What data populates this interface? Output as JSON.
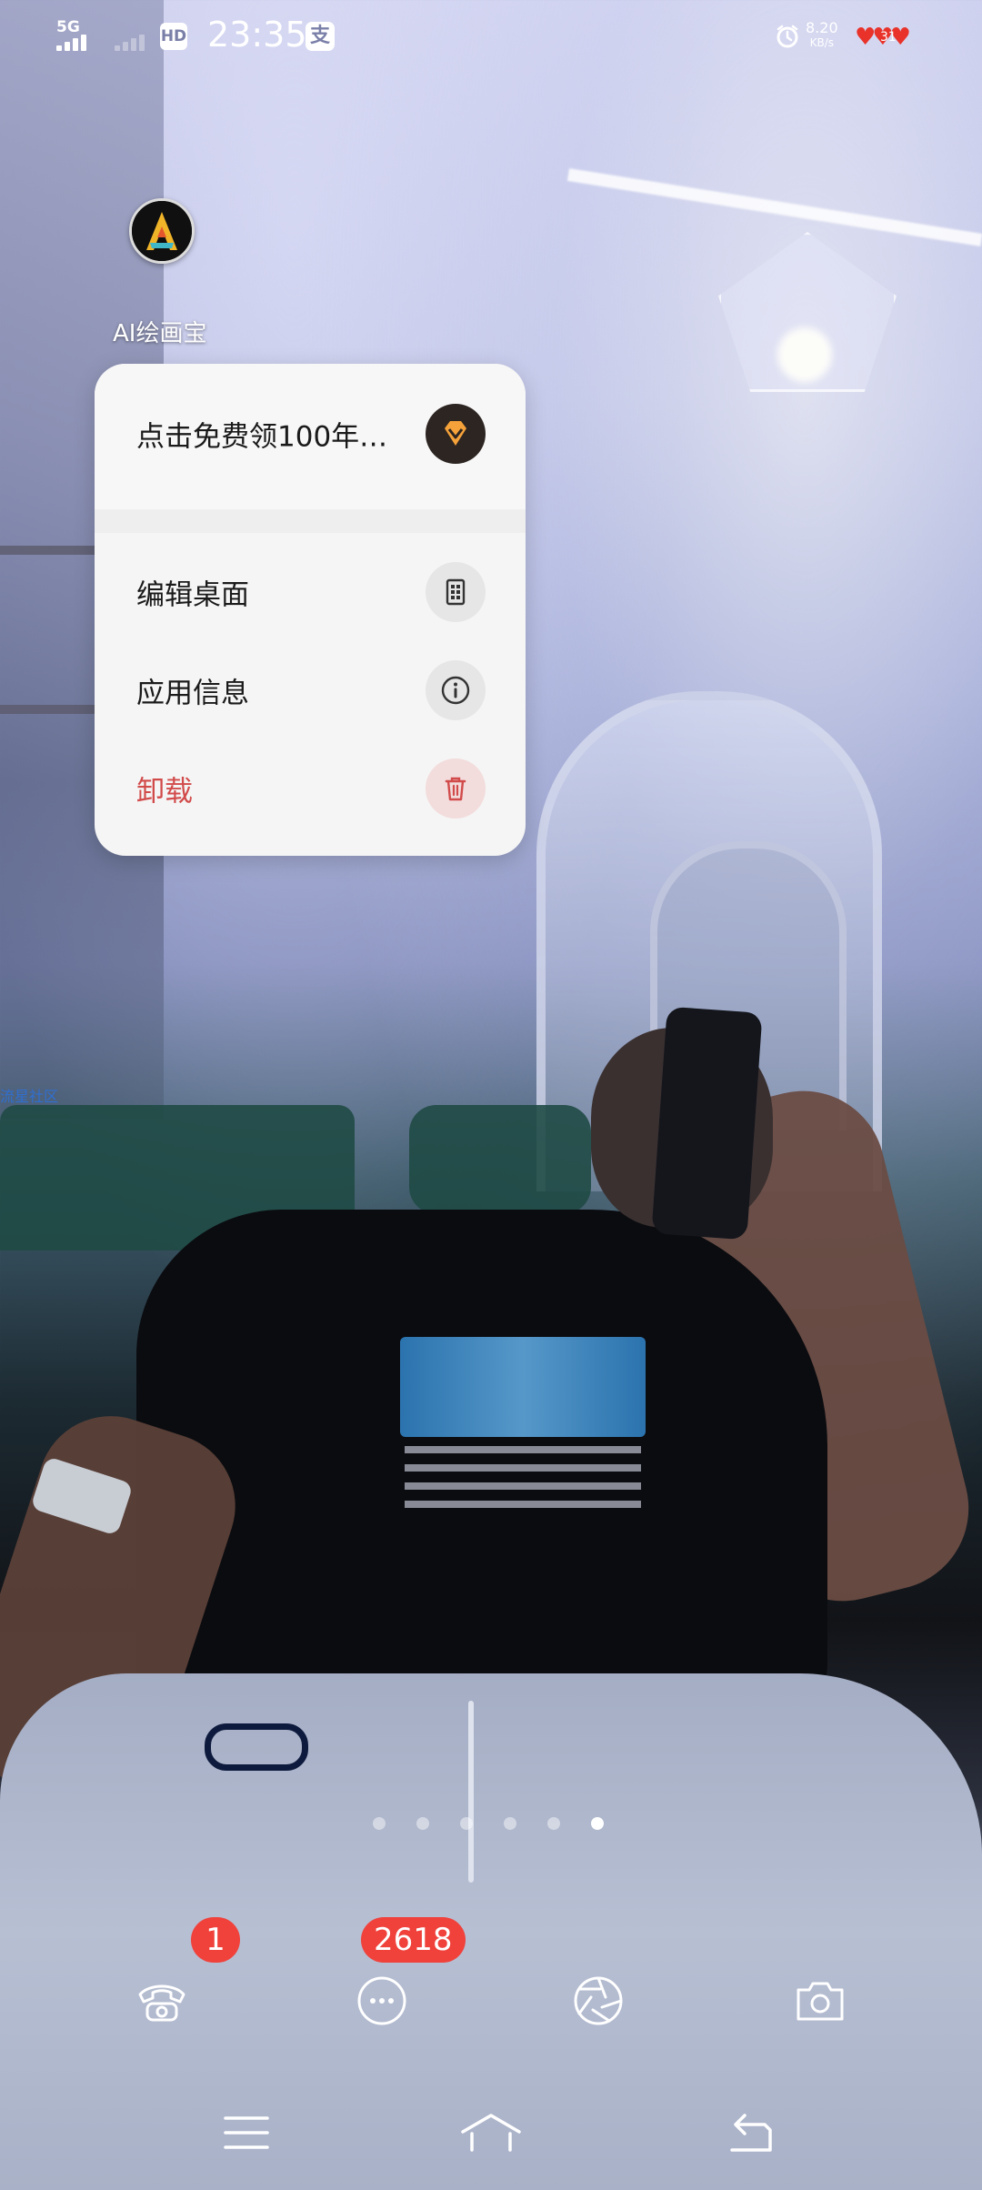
{
  "status_bar": {
    "network": "5G",
    "hd_badge": "HD",
    "time": "23:35",
    "alipay_icon_text": "支",
    "speed_value": "8.20",
    "speed_unit": "KB/s",
    "battery": "31"
  },
  "app": {
    "label": "AI绘画宝",
    "icon": "ai-painting-app-icon"
  },
  "popup": {
    "promo_label": "点击免费领100年…",
    "promo_icon": "diamond-icon",
    "items": [
      {
        "label": "编辑桌面",
        "icon": "edit-desktop-icon"
      },
      {
        "label": "应用信息",
        "icon": "info-icon"
      },
      {
        "label": "卸载",
        "icon": "trash-icon"
      }
    ],
    "danger_color": "#d24b4b"
  },
  "wallpaper_label": "流星社区",
  "page_dots": {
    "total": 6,
    "active_index": 5
  },
  "dock": {
    "apps": [
      {
        "icon": "phone-icon",
        "badge": "1"
      },
      {
        "icon": "messages-icon",
        "badge": "2618"
      },
      {
        "icon": "browser-icon",
        "badge": ""
      },
      {
        "icon": "camera-icon",
        "badge": ""
      }
    ],
    "badge_color": "#f0413b"
  },
  "nav_bar": {
    "buttons": [
      "menu-icon",
      "home-icon",
      "back-icon"
    ]
  }
}
